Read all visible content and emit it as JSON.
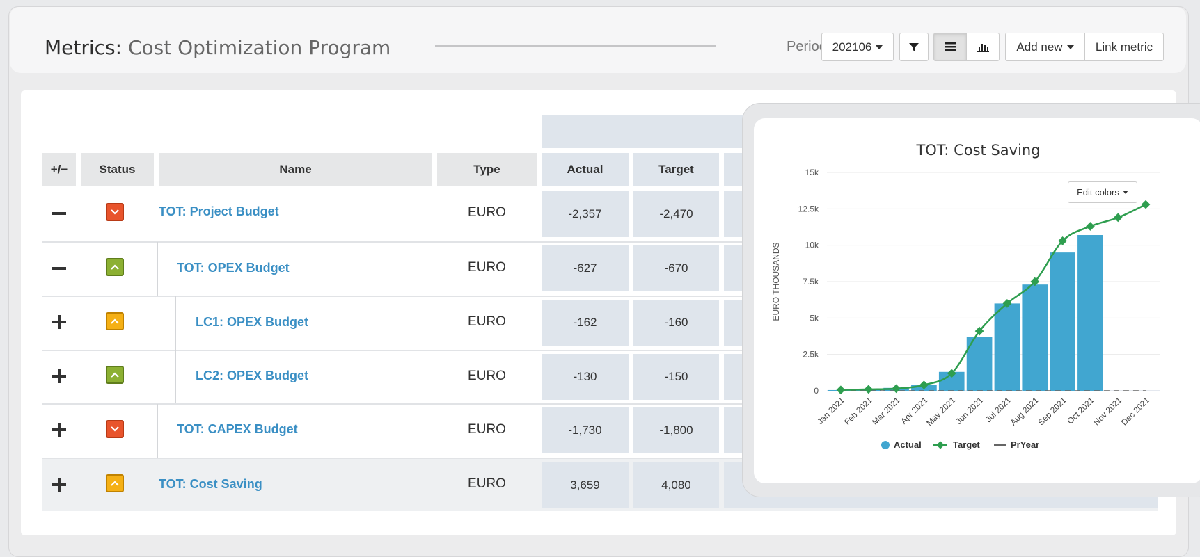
{
  "header": {
    "title_prefix": "Metrics:",
    "title_name": "Cost Optimization Program",
    "period_label": "Period",
    "period_value": "202106",
    "add_new_label": "Add new",
    "link_metric_label": "Link metric"
  },
  "table": {
    "columns": {
      "expand": "+/−",
      "status": "Status",
      "name": "Name",
      "type": "Type",
      "actual": "Actual",
      "target": "Target"
    },
    "rows": [
      {
        "sign": "−",
        "status": "down",
        "name": "TOT: Project Budget",
        "type": "EURO",
        "actual": "-2,357",
        "target": "-2,470"
      },
      {
        "sign": "−",
        "status": "up",
        "name": "TOT: OPEX Budget",
        "type": "EURO",
        "actual": "-627",
        "target": "-670"
      },
      {
        "sign": "+",
        "status": "warn",
        "name": "LC1: OPEX Budget",
        "type": "EURO",
        "actual": "-162",
        "target": "-160"
      },
      {
        "sign": "+",
        "status": "up",
        "name": "LC2: OPEX Budget",
        "type": "EURO",
        "actual": "-130",
        "target": "-150"
      },
      {
        "sign": "+",
        "status": "down",
        "name": "TOT: CAPEX Budget",
        "type": "EURO",
        "actual": "-1,730",
        "target": "-1,800"
      },
      {
        "sign": "+",
        "status": "warn",
        "name": "TOT: Cost Saving",
        "type": "EURO",
        "actual": "3,659",
        "target": "4,080"
      }
    ],
    "status_colors": {
      "down": "#e8542c",
      "up": "#8cb032",
      "warn": "#f5b015"
    }
  },
  "popup": {
    "edit_colors_label": "Edit colors"
  },
  "chart_data": {
    "type": "bar",
    "title": "TOT: Cost Saving",
    "ylabel": "EURO THOUSANDS",
    "ylim": [
      0,
      15000
    ],
    "yticks": [
      "0",
      "2.5k",
      "5k",
      "7.5k",
      "10k",
      "12.5k",
      "15k"
    ],
    "categories": [
      "Jan 2021",
      "Feb 2021",
      "Mar 2021",
      "Apr 2021",
      "May 2021",
      "Jun 2021",
      "Jul 2021",
      "Aug 2021",
      "Sep 2021",
      "Oct 2021",
      "Nov 2021",
      "Dec 2021"
    ],
    "series": [
      {
        "name": "Actual",
        "type": "bar",
        "color": "#41a6d0",
        "values": [
          50,
          80,
          200,
          400,
          1300,
          3700,
          6000,
          7300,
          9500,
          10700,
          null,
          null
        ]
      },
      {
        "name": "Target",
        "type": "line",
        "color": "#2e9e4f",
        "values": [
          60,
          100,
          150,
          400,
          1200,
          4100,
          6000,
          7500,
          10300,
          11300,
          11900,
          12800
        ]
      },
      {
        "name": "PrYear",
        "type": "line",
        "color": "#666666",
        "values": [
          0,
          0,
          0,
          0,
          0,
          0,
          0,
          0,
          0,
          0,
          0,
          0
        ]
      }
    ],
    "legend": "bottom",
    "grid": true
  }
}
